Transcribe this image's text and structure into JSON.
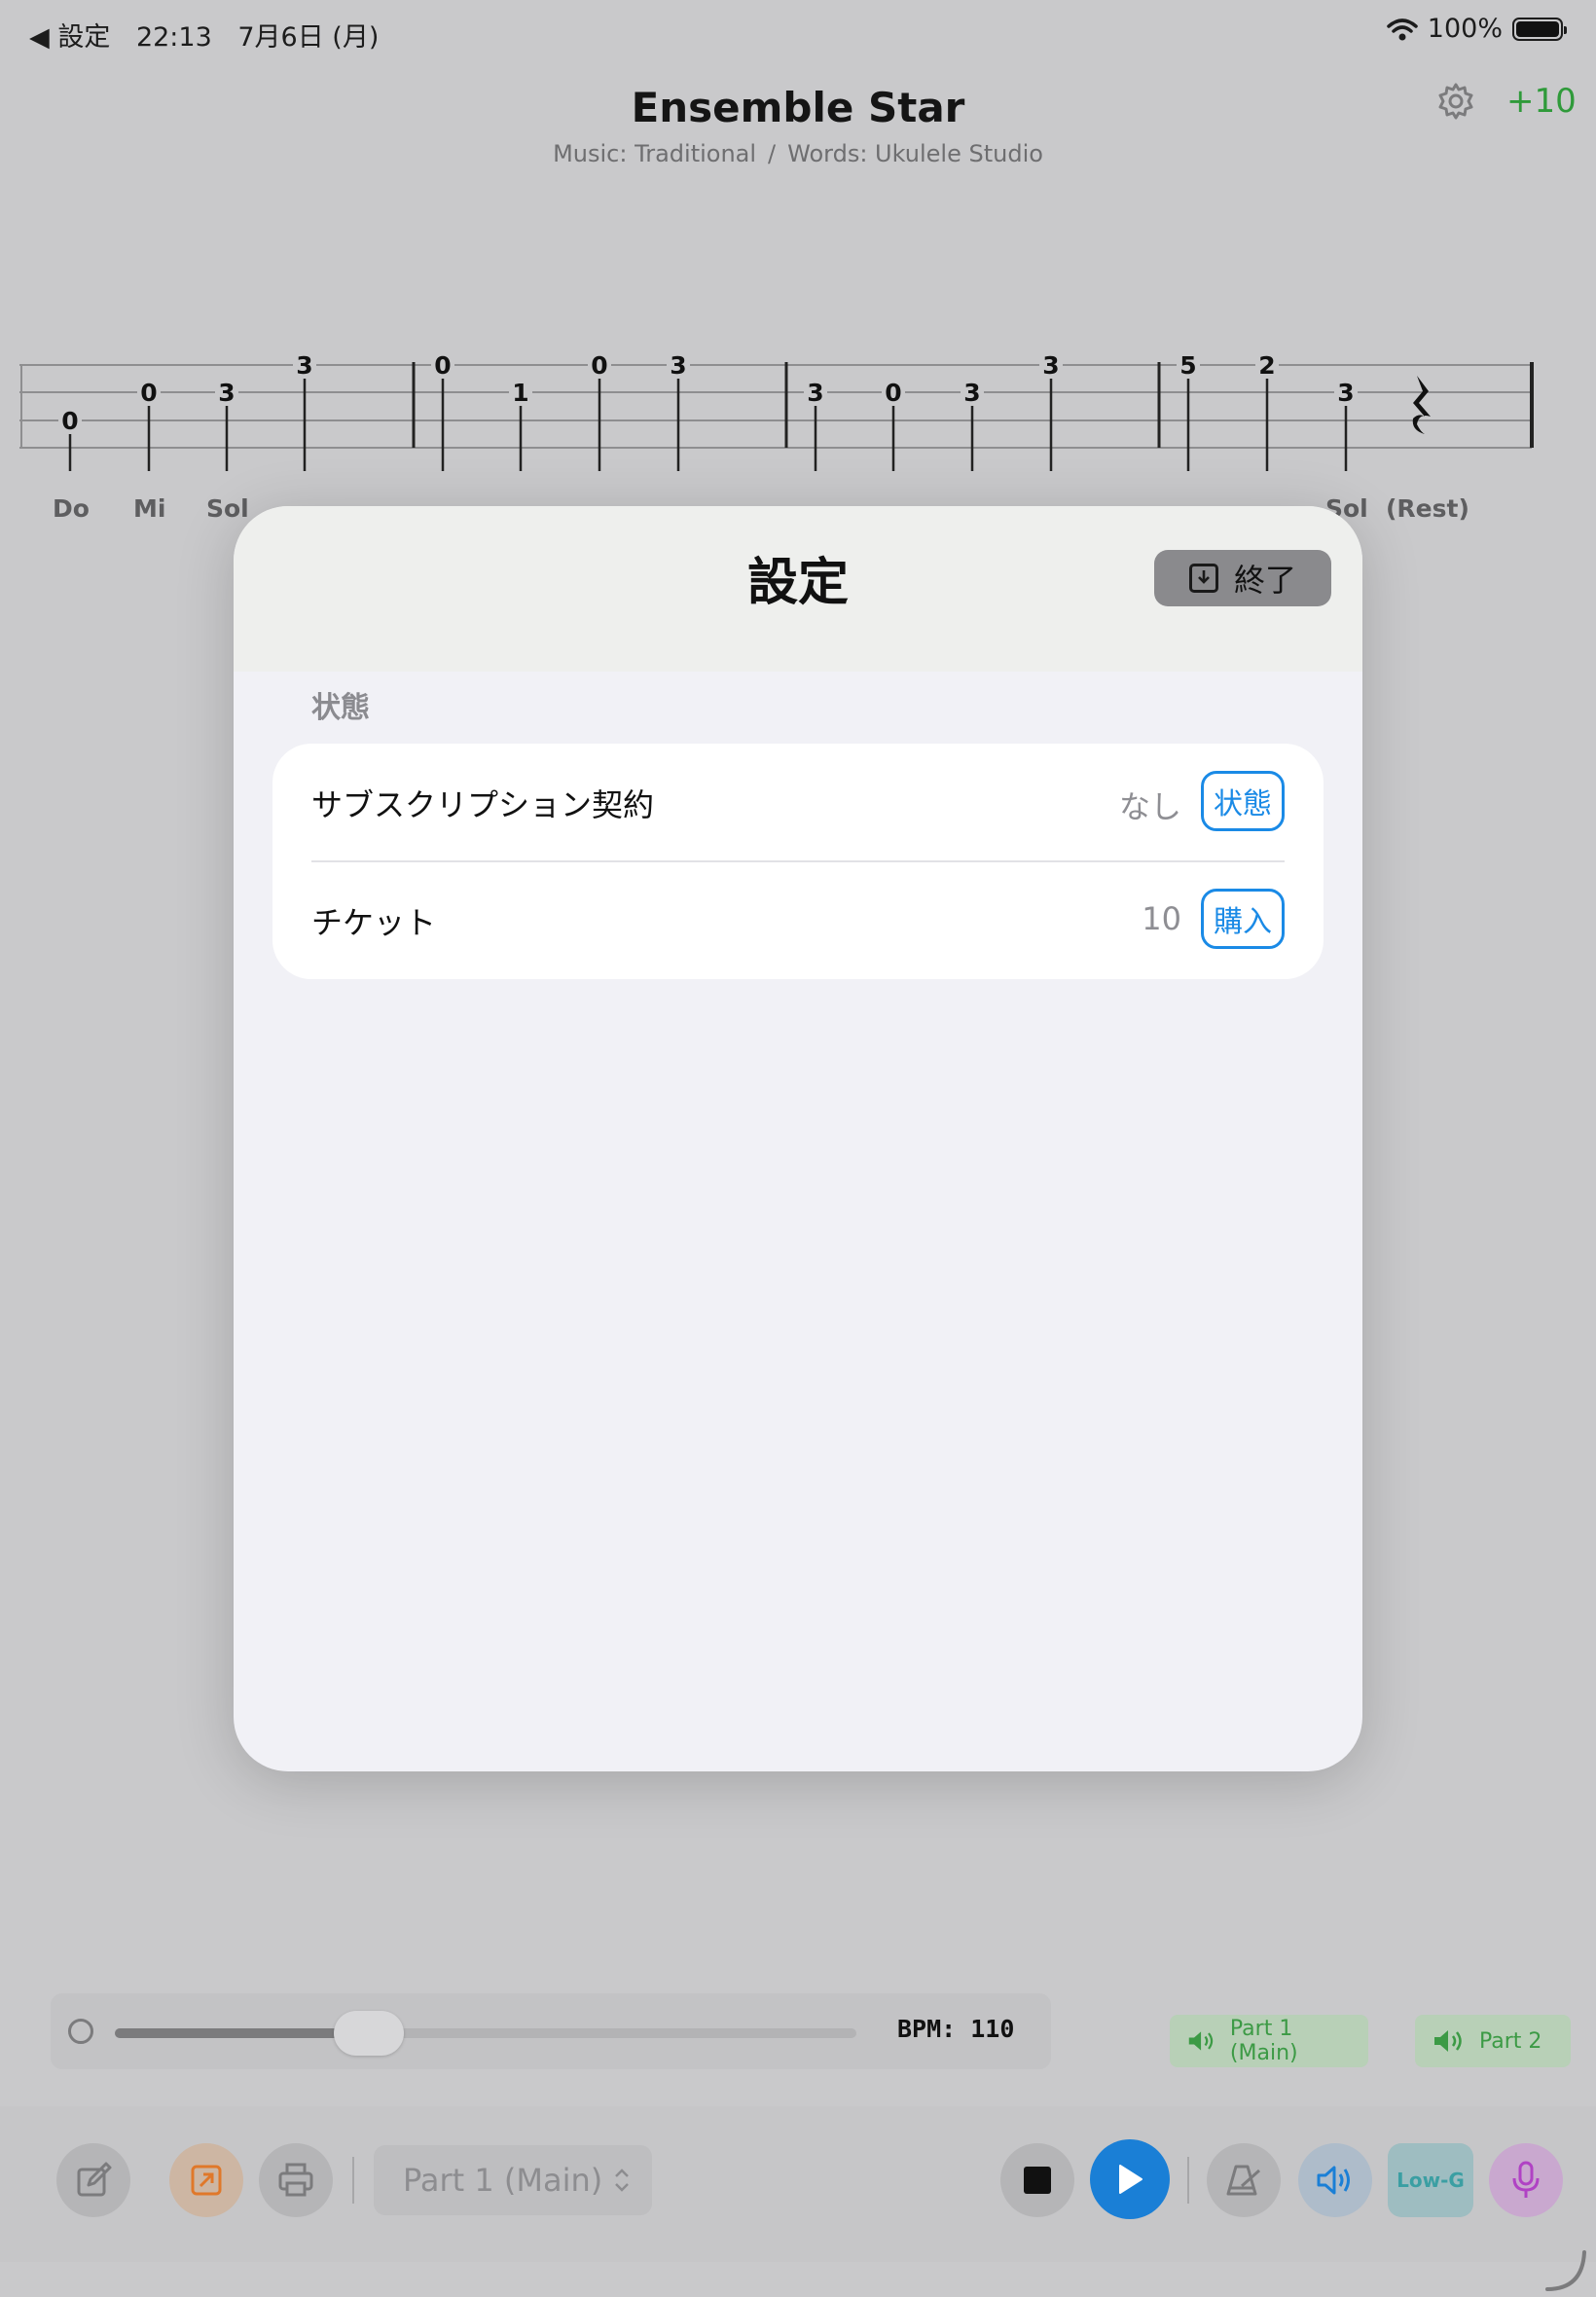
{
  "status_bar": {
    "back_label": "◀ 設定",
    "time": "22:13",
    "date": "7月6日 (月)",
    "battery": "100%"
  },
  "header": {
    "title": "Ensemble Star",
    "music": "Music: Traditional",
    "separator": "/",
    "words": "Words: Ukulele Studio",
    "tickets_delta": "+10"
  },
  "tab": {
    "notes": [
      "0",
      "0",
      "3",
      "3",
      "0",
      "1",
      "0",
      "3",
      "3",
      "0",
      "3",
      "3",
      "5",
      "2",
      "3"
    ],
    "solfege_visible": [
      "Do",
      "Mi",
      "Sol",
      "Sol",
      "(Rest)"
    ]
  },
  "modal": {
    "title": "設定",
    "done_label": "終了",
    "section_label": "状態",
    "rows": [
      {
        "label": "サブスクリプション契約",
        "value": "なし",
        "button": "状態"
      },
      {
        "label": "チケット",
        "value": "10",
        "button": "購入"
      }
    ]
  },
  "player": {
    "bpm_label": "BPM: 110",
    "tempo_position": 0.33,
    "parts": [
      "Part 1 (Main)",
      "Part 2"
    ],
    "selected_part": "Part 1 (Main)",
    "tuning_label": "Low-G"
  },
  "colors": {
    "accent_blue": "#1a8ae6",
    "play_blue": "#1a7fd6",
    "green": "#2f9a3a",
    "orange": "#e0782a",
    "purple": "#b042c4"
  }
}
